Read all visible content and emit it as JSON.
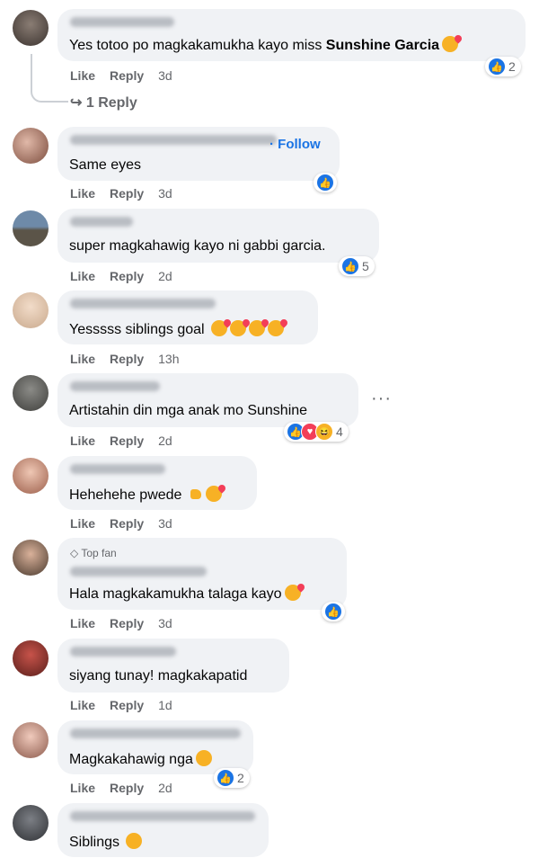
{
  "actions": {
    "like": "Like",
    "reply": "Reply"
  },
  "comments": [
    {
      "text_plain": "Yes totoo po magkakamukha kayo miss ",
      "mention": "Sunshine Garcia",
      "time": "3d",
      "reactions": "2"
    },
    {
      "follow": "Follow",
      "text": "Same eyes",
      "time": "3d"
    },
    {
      "text": "super magkahawig kayo ni gabbi garcia.",
      "time": "2d",
      "reactions": "5"
    },
    {
      "text": "Yesssss siblings goal",
      "time": "13h"
    },
    {
      "text": "Artistahin din mga anak mo Sunshine",
      "time": "2d",
      "reactions": "4"
    },
    {
      "text": "Hehehehe pwede",
      "time": "3d"
    },
    {
      "badge": "Top fan",
      "text": "Hala magkakamukha talaga kayo",
      "time": "3d"
    },
    {
      "text": "siyang tunay! magkakapatid",
      "time": "1d"
    },
    {
      "text": "Magkakahawig nga",
      "time": "2d",
      "reactions": "2"
    },
    {
      "text": "Siblings"
    }
  ],
  "replies_link": "1 Reply",
  "colors": {
    "bubble": "#f0f2f5",
    "accent": "#1b74e4",
    "meta": "#65676b"
  },
  "icons": [
    "like-reaction-icon",
    "love-reaction-icon",
    "haha-reaction-icon",
    "diamond-icon",
    "reply-arrow-icon",
    "more-options-icon"
  ]
}
